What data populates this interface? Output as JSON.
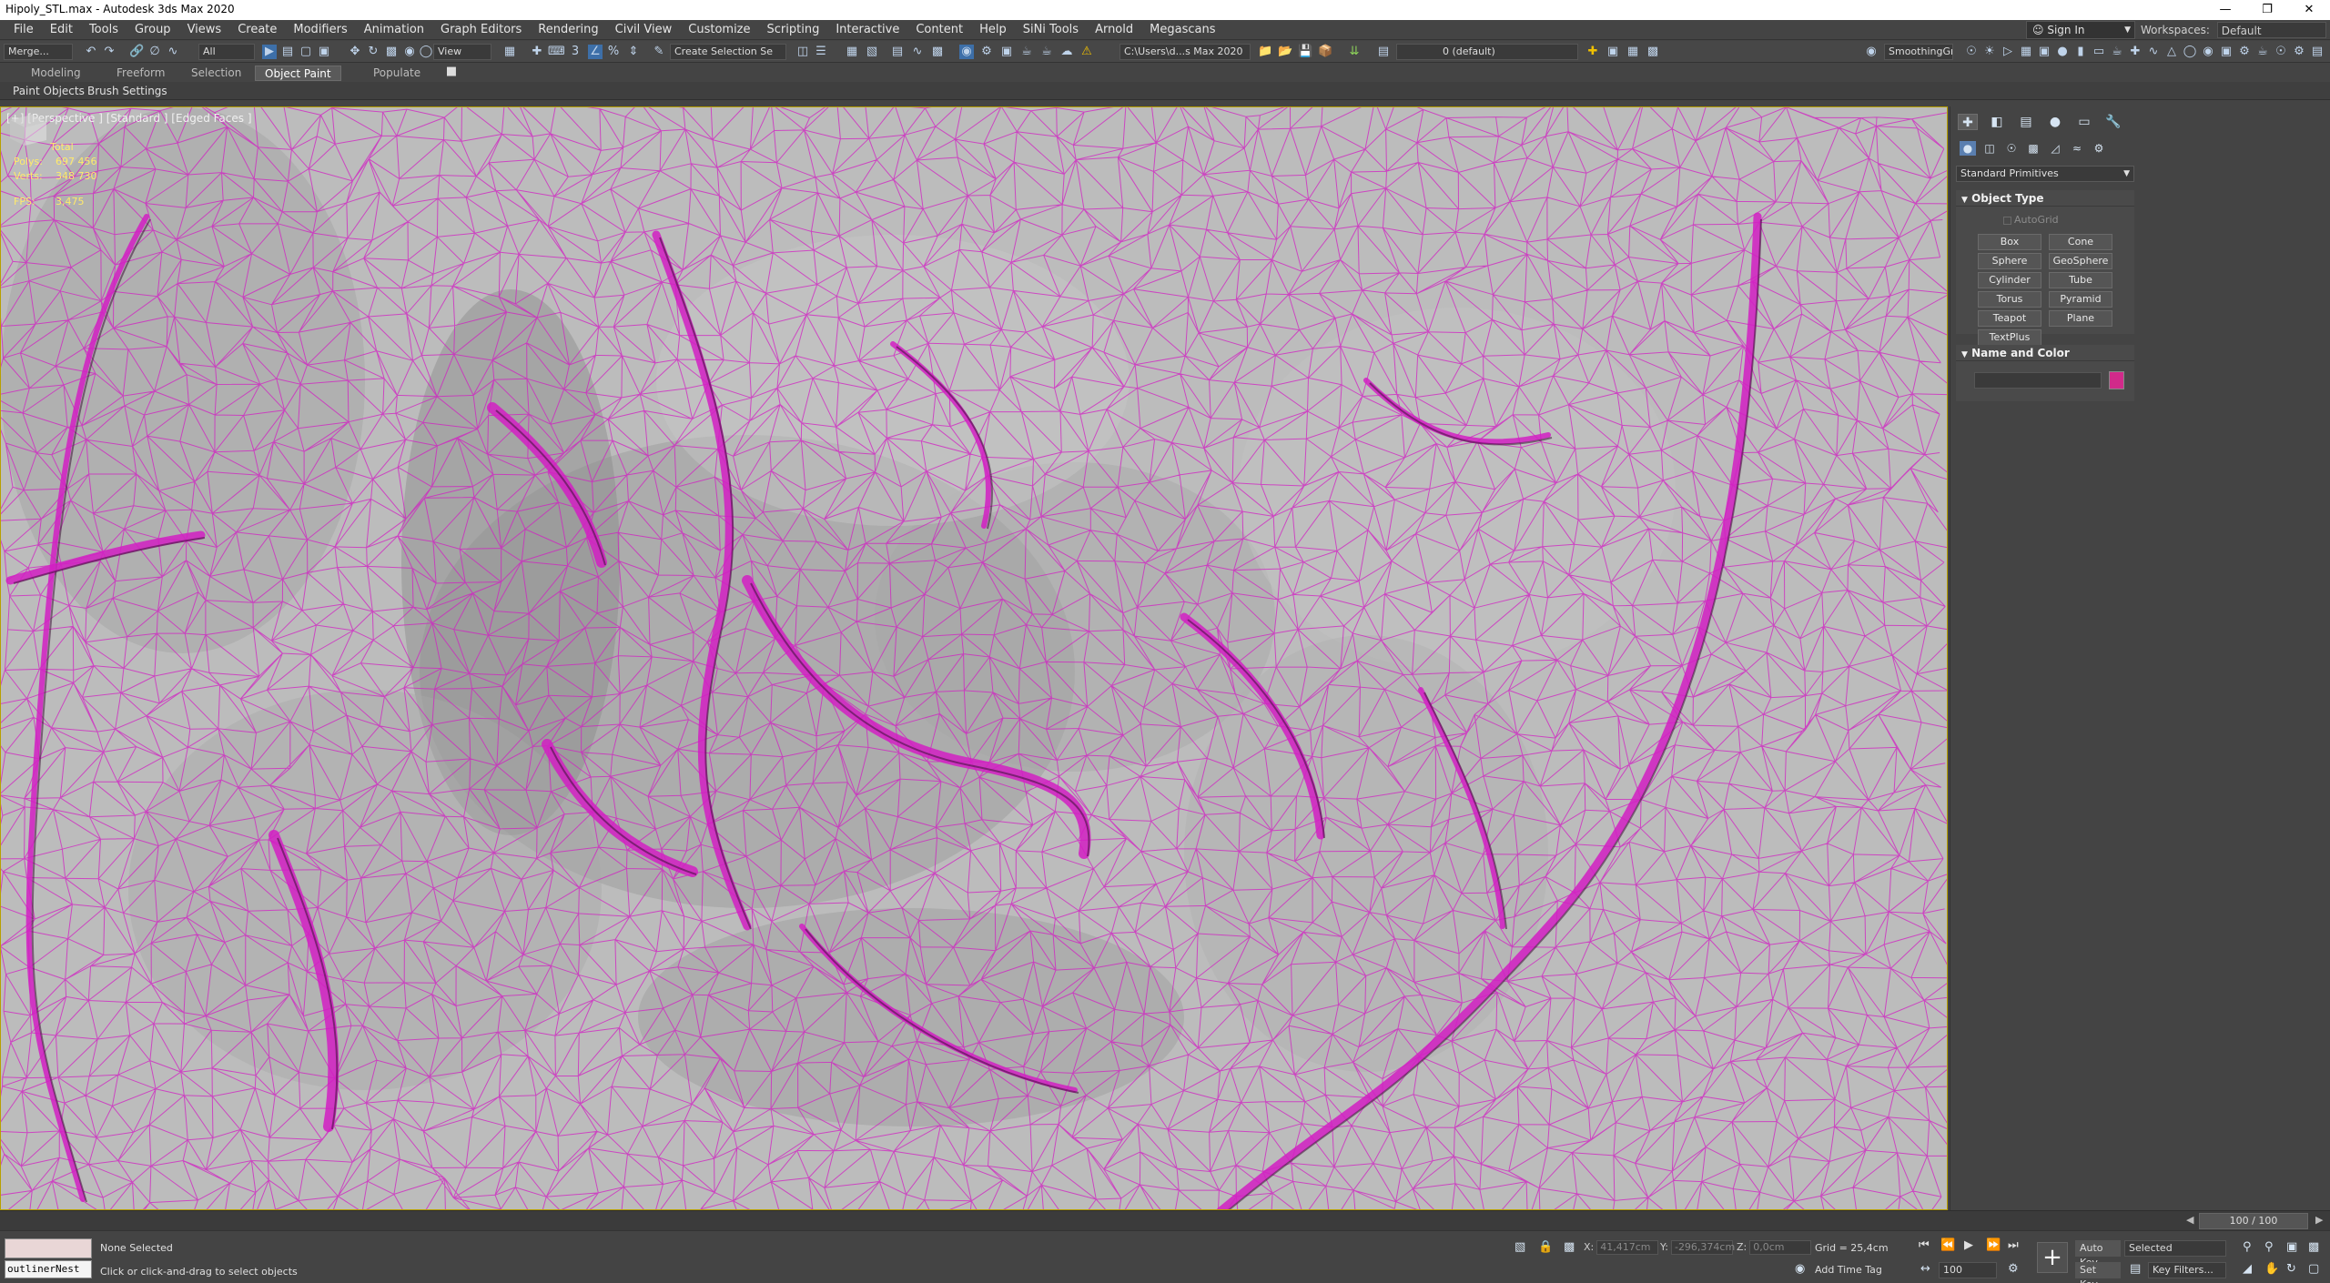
{
  "window": {
    "title": "Hipoly_STL.max - Autodesk 3ds Max 2020"
  },
  "menu": [
    "File",
    "Edit",
    "Tools",
    "Group",
    "Views",
    "Create",
    "Modifiers",
    "Animation",
    "Graph Editors",
    "Rendering",
    "Civil View",
    "Customize",
    "Scripting",
    "Interactive",
    "Content",
    "Help",
    "SiNi Tools",
    "Arnold",
    "Megascans"
  ],
  "account": {
    "sign_in": "Sign In",
    "workspaces_label": "Workspaces:",
    "workspace_value": "Default"
  },
  "toolbar": {
    "merge": "Merge...",
    "filter_all": "All",
    "ref_coord": "View",
    "selection_set": "Create Selection Se",
    "project_path": "C:\\Users\\d...s Max 2020",
    "layer": "0 (default)",
    "smoothing": "SmoothingGr"
  },
  "ribbon": {
    "tabs": [
      "Modeling",
      "Freeform",
      "Selection",
      "Object Paint",
      "Populate"
    ],
    "active_tab": "Object Paint",
    "sub_items": [
      "Paint Objects",
      "Brush Settings"
    ]
  },
  "viewport": {
    "label": "[+] [Perspective ] [Standard ] [Edged Faces ]",
    "stats": {
      "header": "Total",
      "polys_label": "Polys:",
      "polys_value": "697 456",
      "verts_label": "Verts:",
      "verts_value": "348 730",
      "fps_label": "FPS:",
      "fps_value": "3,475"
    },
    "wire_color": "#d21fc3",
    "surface_color": "#bcbcbc"
  },
  "command_panel": {
    "category": "Standard Primitives",
    "object_type_title": "Object Type",
    "autogrid_label": "AutoGrid",
    "primitives": [
      "Box",
      "Cone",
      "Sphere",
      "GeoSphere",
      "Cylinder",
      "Tube",
      "Torus",
      "Pyramid",
      "Teapot",
      "Plane",
      "TextPlus"
    ],
    "name_color_title": "Name and Color",
    "object_color": "#d12a8a"
  },
  "timeline": {
    "frame": "100 / 100"
  },
  "status": {
    "selection": "None Selected",
    "prompt": "Click or click-and-drag to select objects",
    "mxs_input": "outlinerNest",
    "x_label": "X:",
    "x_value": "41,417cm",
    "y_label": "Y:",
    "y_value": "-296,374cm",
    "z_label": "Z:",
    "z_value": "0,0cm",
    "grid": "Grid = 25,4cm",
    "add_time_tag": "Add Time Tag",
    "auto_key": "Auto Key",
    "key_mode": "Selected",
    "set_key": "Set Key",
    "key_filters": "Key Filters...",
    "current_frame": "100"
  }
}
